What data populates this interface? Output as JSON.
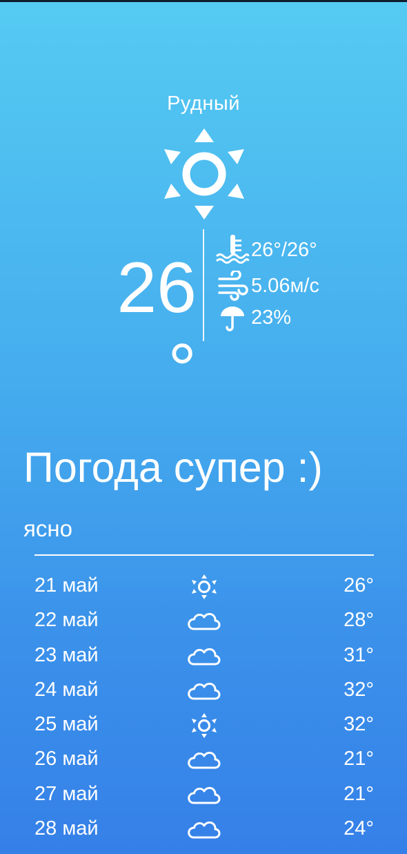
{
  "city": "Рудный",
  "current": {
    "temperature": "26 °",
    "icon": "sun-icon",
    "details": {
      "feels_like": "26°/26°",
      "wind": "5.06м/с",
      "precipitation": "23%"
    }
  },
  "headline": "Погода супер :)",
  "condition": "ясно",
  "forecast": [
    {
      "date": "21 май",
      "icon": "sun-icon",
      "temp": "26°"
    },
    {
      "date": "22 май",
      "icon": "cloud-icon",
      "temp": "28°"
    },
    {
      "date": "23 май",
      "icon": "cloud-icon",
      "temp": "31°"
    },
    {
      "date": "24 май",
      "icon": "cloud-icon",
      "temp": "32°"
    },
    {
      "date": "25 май",
      "icon": "sun-icon",
      "temp": "32°"
    },
    {
      "date": "26 май",
      "icon": "cloud-icon",
      "temp": "21°"
    },
    {
      "date": "27 май",
      "icon": "cloud-icon",
      "temp": "21°"
    },
    {
      "date": "28 май",
      "icon": "cloud-icon",
      "temp": "24°"
    }
  ],
  "colors": {
    "gradient_top": "#55cbf2",
    "gradient_bottom": "#3580e8",
    "text": "#ffffff"
  }
}
